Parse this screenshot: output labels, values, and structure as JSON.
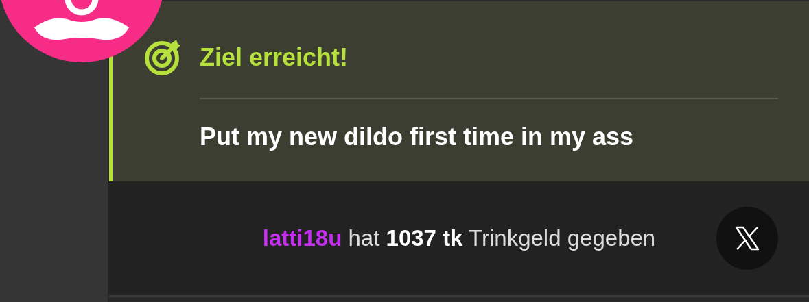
{
  "goal": {
    "title": "Ziel erreicht!",
    "description": "Put my new dildo first time in my ass"
  },
  "tip": {
    "username": "latti18u",
    "message": "hat **1037 tk** Trinkgeld gegeben"
  }
}
